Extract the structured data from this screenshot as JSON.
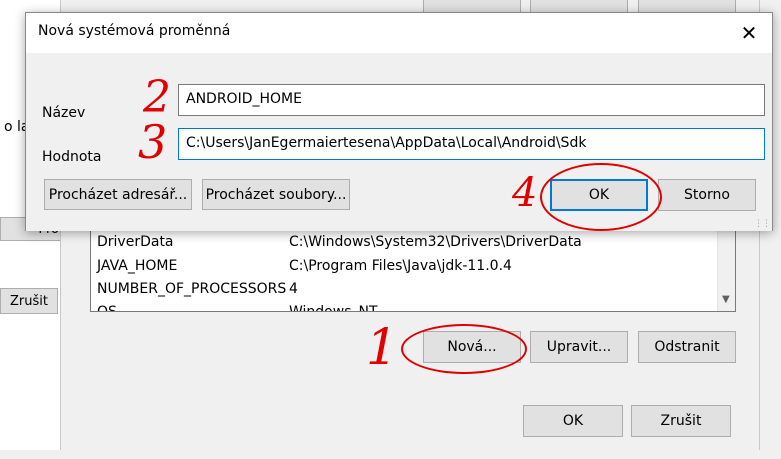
{
  "background_window": {
    "partial_text": "o lad",
    "partial_button": "Pro",
    "cancel_button": "Zrušit"
  },
  "env_window": {
    "variables": [
      {
        "name": "DriverData",
        "value": "C:\\Windows\\System32\\Drivers\\DriverData"
      },
      {
        "name": "JAVA_HOME",
        "value": "C:\\Program Files\\Java\\jdk-11.0.4"
      },
      {
        "name": "NUMBER_OF_PROCESSORS",
        "value": "4"
      },
      {
        "name": "OS",
        "value": "Windows_NT"
      }
    ],
    "new_button": "Nová...",
    "edit_button": "Upravit...",
    "delete_button": "Odstranit",
    "ok_button": "OK",
    "cancel_button": "Zrušit"
  },
  "dialog": {
    "title": "Nová systémová proměnná",
    "name_label": "Název",
    "name_value": "ANDROID_HOME",
    "value_label": "Hodnota",
    "value_value": "C:\\Users\\JanEgermaiertesena\\AppData\\Local\\Android\\Sdk",
    "browse_dir_button": "Procházet adresář...",
    "browse_files_button": "Procházet soubory...",
    "ok_button": "OK",
    "cancel_button": "Storno"
  },
  "annotations": {
    "step1": "1",
    "step2": "2",
    "step3": "3",
    "step4": "4",
    "color": "#e00000"
  },
  "colors": {
    "accent": "#0078d7",
    "window_bg": "#f0f0f0"
  }
}
